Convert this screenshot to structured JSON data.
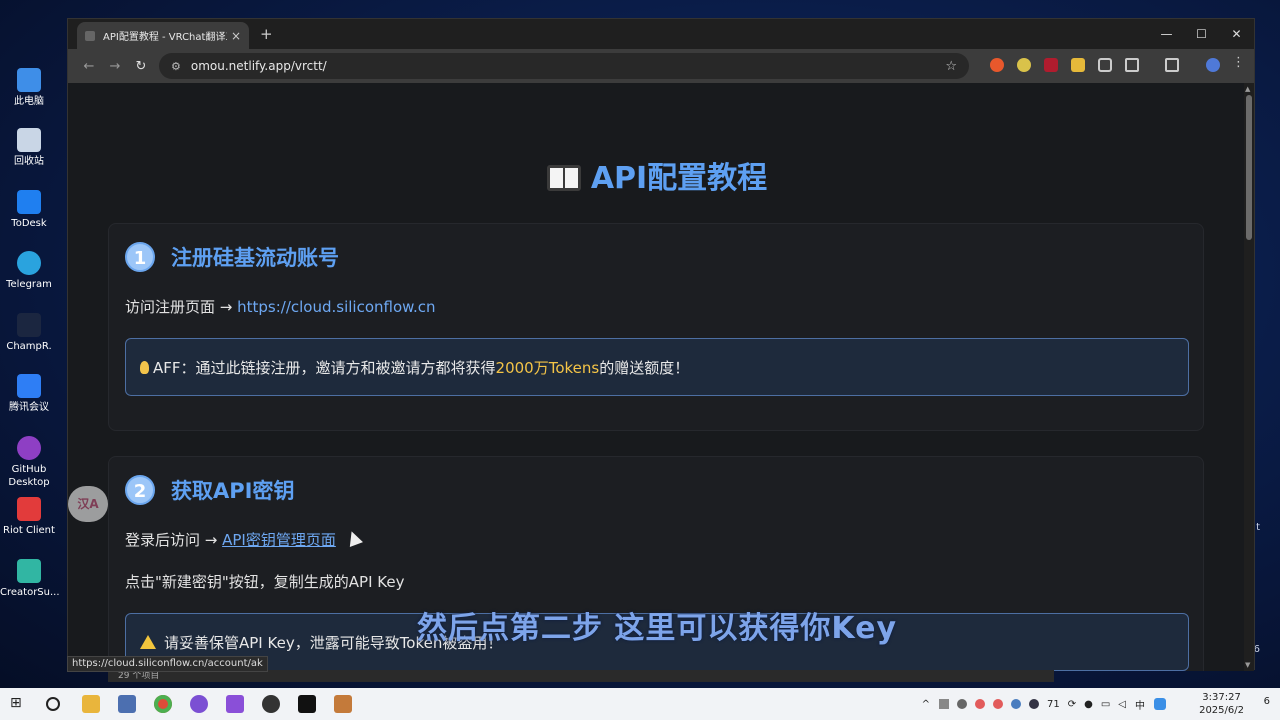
{
  "desktop": {
    "icons": [
      "此电脑",
      "回收站",
      "ToDesk",
      "Telegram",
      "ChampR.",
      "腾讯会议",
      "GitHub Desktop",
      "Riot Client",
      "CreatorSu..."
    ],
    "right_fragments": [
      "t",
      "6"
    ]
  },
  "browser": {
    "tab_title": "API配置教程 - VRChat翻译工具",
    "tab_close": "×",
    "new_tab": "+",
    "controls": {
      "minimize": "—",
      "maximize": "☐",
      "close": "✕"
    },
    "back": "←",
    "forward": "→",
    "reload": "↻",
    "url": "omou.netlify.app/vrctt/",
    "bookmark_star": "☆"
  },
  "page": {
    "title": "API配置教程",
    "step1": {
      "number": "1",
      "title": "注册硅基流动账号",
      "visit_text": "访问注册页面 → ",
      "link": "https://cloud.siliconflow.cn",
      "note_prefix": "AFF：通过此链接注册，邀请方和被邀请方都将获得",
      "note_highlight": "2000万Tokens",
      "note_suffix": "的赠送额度！"
    },
    "step2": {
      "number": "2",
      "title": "获取API密钥",
      "visit_text": "登录后访问 → ",
      "link": "API密钥管理页面",
      "instruction": "点击\"新建密钥\"按钮，复制生成的API Key",
      "warning": "请妥善保管API Key，泄露可能导致Token被盗用！"
    }
  },
  "overlay": {
    "subtitle": "然后点第二步 这里可以获得你Key",
    "translate_button": "汉A",
    "status_url": "https://cloud.siliconflow.cn/account/ak",
    "explorer_count": "29 个项目"
  },
  "taskbar": {
    "time": "3:37:27",
    "date": "2025/6/2",
    "tray_number": "71",
    "ime": "中",
    "notification_count": "6"
  }
}
